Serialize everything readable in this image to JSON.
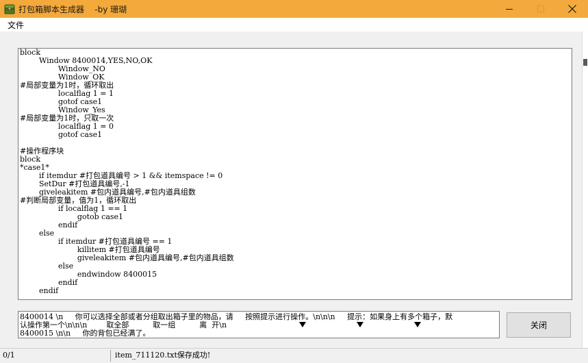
{
  "window": {
    "title": "打包箱脚本生成器    -by 珊瑚",
    "icon": "treasure-chest-icon",
    "colors": {
      "titlebar": "#f3a93b",
      "panel": "#f0f0f0"
    }
  },
  "menu": {
    "file_label": "文件"
  },
  "script_text": [
    "block",
    "        Window 8400014,YES,NO,OK",
    "                Window_NO",
    "                Window_OK",
    "#局部变量为1时，循环取出",
    "                localflag 1 = 1",
    "                gotof case1",
    "                Window_Yes",
    "#局部变量为1时，只取一次",
    "                localflag 1 = 0",
    "                gotof case1",
    "",
    "#操作程序块",
    "block",
    "*case1*",
    "        if itemdur #打包道具编号 > 1 && itemspace != 0",
    "        SetDur #打包道具编号,-1",
    "        giveleakitem #包内道具编号,#包内道具组数",
    "#判断局部变量，值为1，循环取出",
    "                if localflag 1 == 1",
    "                        gotob case1",
    "                endif",
    "        else",
    "                if itemdur #打包道具编号 == 1",
    "                        killitem #打包道具编号",
    "                        giveleakitem #包内道具编号,#包内道具组数",
    "                else",
    "                        endwindow 8400015",
    "                endif",
    "        endif"
  ],
  "message_text": [
    "8400014 \\n     你可以选择全部或者分组取出箱子里的物品，请     按照提示进行操作。\\n\\n\\n     提示：如果身上有多个箱子，默",
    "认操作第一个\\n\\n\\n        取全部          取一组          离  开\\n",
    "8400015 \\n\\n     你的背包已经满了。"
  ],
  "close_button_label": "关闭",
  "status": {
    "count": "0/1",
    "message": "item_711120.txt保存成功!"
  }
}
